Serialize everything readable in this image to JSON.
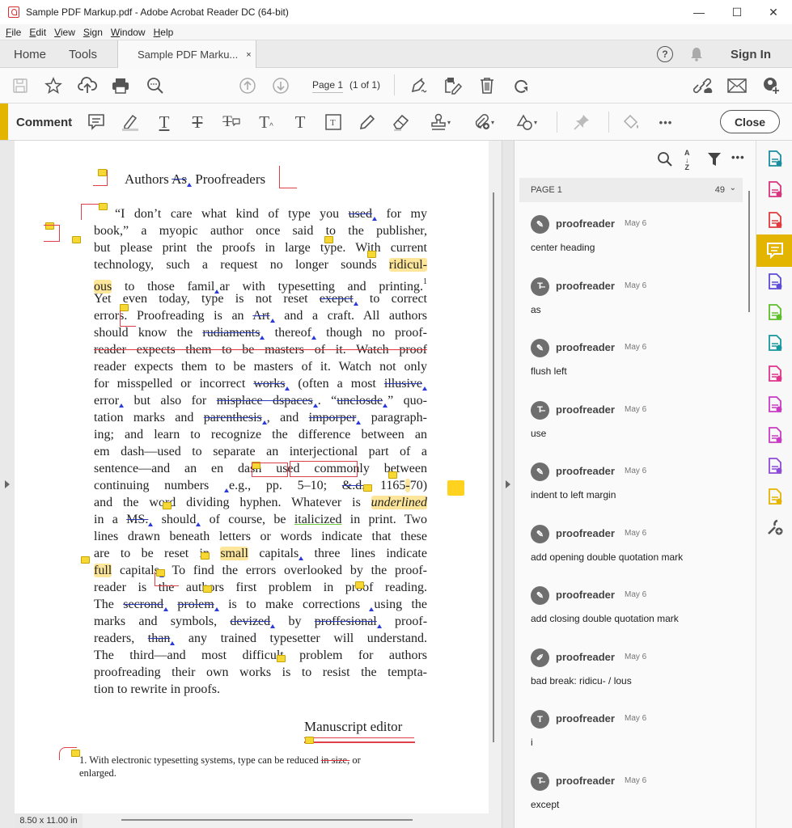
{
  "window": {
    "title": "Sample PDF Markup.pdf - Adobe Acrobat Reader DC (64-bit)",
    "controls": {
      "minimize": "—",
      "maximize": "☐",
      "close": "✕"
    }
  },
  "menu": [
    "File",
    "Edit",
    "View",
    "Sign",
    "Window",
    "Help"
  ],
  "tabs": {
    "home": "Home",
    "tools": "Tools",
    "document": "Sample PDF Marku...",
    "close_glyph": "×",
    "sign_in": "Sign In"
  },
  "toolbar": {
    "page_field": "Page 1",
    "page_of": "(1 of 1)",
    "icons": [
      "save-icon",
      "bookmark-star-icon",
      "cloud-upload-icon",
      "print-icon",
      "zoom-search-icon",
      "page-up-icon",
      "page-down-icon",
      "fill-sign-icon",
      "edit-pdf-icon",
      "delete-icon",
      "rotate-icon",
      "share-link-icon",
      "email-icon",
      "add-user-icon"
    ]
  },
  "comment_toolbar": {
    "label": "Comment",
    "close_label": "Close",
    "more_glyph": "•••",
    "tools": [
      "sticky-note",
      "highlight",
      "underline",
      "strikethrough",
      "replace-text",
      "insert-text",
      "add-text",
      "text-box",
      "pencil",
      "eraser",
      "stamp",
      "attach",
      "shapes",
      "pin",
      "fill-color"
    ]
  },
  "document": {
    "heading": {
      "pre": "Authors ",
      "struck": "As",
      "post": " Proofreaders"
    },
    "lines": [
      [
        {
          "t": "“I don’t care what kind of type you "
        },
        {
          "t": "used",
          "s": "b"
        },
        {
          "c": 1
        },
        {
          "t": " for my"
        }
      ],
      [
        {
          "t": "book,” a myopic author once said to the publisher,"
        }
      ],
      [
        {
          "t": "but please print the proofs in large type. With current"
        }
      ],
      [
        {
          "t": "technology, such a request no longer sounds "
        },
        {
          "t": "ridicul-",
          "h": 1
        }
      ],
      [
        {
          "t": "ous",
          "h": 1
        },
        {
          "t": " to those famil"
        },
        {
          "c": 1
        },
        {
          "t": "ar with typesetting and printing."
        },
        {
          "sup": "1"
        }
      ],
      [
        {
          "t": "Yet even today, type is not reset "
        },
        {
          "t": "exepct",
          "s": "b"
        },
        {
          "c": 1
        },
        {
          "t": " to correct"
        }
      ],
      [
        {
          "t": "errors. Proofreading is an "
        },
        {
          "t": "Art",
          "s": "b"
        },
        {
          "c": 1
        },
        {
          "t": " and a craft. All authors"
        }
      ],
      [
        {
          "t": "should know the "
        },
        {
          "t": "rudiaments",
          "s": "b"
        },
        {
          "c": 1
        },
        {
          "t": " thereof"
        },
        {
          "c": 1
        },
        {
          "t": " though no proof-"
        }
      ],
      [
        {
          "t": "reader expects them to be masters of it. Watch proof",
          "s": "r"
        }
      ],
      [
        {
          "t": "reader expects them to be masters of it. Watch not only"
        }
      ],
      [
        {
          "t": "for misspelled or incorrect "
        },
        {
          "t": "works",
          "s": "b"
        },
        {
          "c": 1
        },
        {
          "t": " (often a most "
        },
        {
          "t": "illusive",
          "s": "b"
        },
        {
          "c": 1
        }
      ],
      [
        {
          "t": "error"
        },
        {
          "c": 1
        },
        {
          "t": " but also for "
        },
        {
          "t": "misplace dspaces",
          "s": "b"
        },
        {
          "c": 1
        },
        {
          "t": ". “"
        },
        {
          "t": "unclosde",
          "s": "b"
        },
        {
          "c": 1
        },
        {
          "t": "” quo-"
        }
      ],
      [
        {
          "t": "tation marks and "
        },
        {
          "t": "parenthesis",
          "s": "b"
        },
        {
          "c": 1
        },
        {
          "t": ", and "
        },
        {
          "t": "imporper",
          "s": "b"
        },
        {
          "c": 1
        },
        {
          "t": " paragraph-"
        }
      ],
      [
        {
          "t": "ing; and learn to recognize the difference between an"
        }
      ],
      [
        {
          "t": "em dash—used to separate an interjectional part of a"
        }
      ],
      [
        {
          "t": "sentence—and an en dash used commonly between"
        }
      ],
      [
        {
          "t": "continuing numbers "
        },
        {
          "c": 1
        },
        {
          "t": "e.g., pp. 5–10; "
        },
        {
          "t": "&.d.",
          "s": "b"
        },
        {
          "t": " 1165"
        },
        {
          "t": "-",
          "h": 1
        },
        {
          "t": "70)"
        }
      ],
      [
        {
          "t": "and the word dividing hyphen. Whatever is "
        },
        {
          "t": "underlined",
          "h": 1,
          "i": 1
        }
      ],
      [
        {
          "t": "in a "
        },
        {
          "t": "MS.",
          "s": "b"
        },
        {
          "c": 1
        },
        {
          "t": " should"
        },
        {
          "c": 1
        },
        {
          "t": " of course, be "
        },
        {
          "t": "italicized",
          "u": 1
        },
        {
          "t": " in print. Two"
        }
      ],
      [
        {
          "t": "lines drawn beneath letters or words indicate that these"
        }
      ],
      [
        {
          "t": "are to be reset in "
        },
        {
          "t": "small",
          "h": 1
        },
        {
          "t": " capitals"
        },
        {
          "c": 1
        },
        {
          "t": " three lines indicate"
        }
      ],
      [
        {
          "t": "full",
          "h": 1
        },
        {
          "t": " capitals"
        },
        {
          "c": 1
        },
        {
          "t": " To find the errors overlooked by the proof-"
        }
      ],
      [
        {
          "t": "reader is the authors first problem in proof reading."
        }
      ],
      [
        {
          "t": "The "
        },
        {
          "t": "secrond",
          "s": "b"
        },
        {
          "c": 1
        },
        {
          "t": " "
        },
        {
          "t": "prolem",
          "s": "b"
        },
        {
          "c": 1
        },
        {
          "t": " is to make corrections "
        },
        {
          "c": 1
        },
        {
          "t": "using the"
        }
      ],
      [
        {
          "t": "marks and symbols, "
        },
        {
          "t": "devized",
          "s": "b"
        },
        {
          "c": 1
        },
        {
          "t": " by "
        },
        {
          "t": "proffesional",
          "s": "b"
        },
        {
          "c": 1
        },
        {
          "t": " proof-"
        }
      ],
      [
        {
          "t": "readers, "
        },
        {
          "t": "than",
          "s": "b"
        },
        {
          "c": 1
        },
        {
          "t": " any trained typesetter will understand."
        }
      ],
      [
        {
          "t": "The third—and most difficult problem for authors"
        }
      ],
      [
        {
          "t": "proofreading their own works is to resist the tempta-"
        }
      ],
      [
        {
          "t": "tion to rewrite in proofs."
        }
      ]
    ],
    "signature": "Manuscript editor",
    "footnote": {
      "pre": "1. With electronic typesetting systems, type can be reduced ",
      "struck": "in size,",
      "post": " or",
      "line2": "enlarged."
    },
    "page_size": "8.50 x 11.00 in"
  },
  "comments_panel": {
    "group_label": "PAGE 1",
    "count": "49",
    "items": [
      {
        "author": "proofreader",
        "date": "May 6",
        "text": "center heading",
        "icon": "pencil-icon",
        "glyph": "✎"
      },
      {
        "author": "proofreader",
        "date": "May 6",
        "text": "as",
        "icon": "strikethrough-icon",
        "glyph": "T̶"
      },
      {
        "author": "proofreader",
        "date": "May 6",
        "text": "flush left",
        "icon": "pencil-icon",
        "glyph": "✎"
      },
      {
        "author": "proofreader",
        "date": "May 6",
        "text": "use",
        "icon": "strikethrough-icon",
        "glyph": "T̶"
      },
      {
        "author": "proofreader",
        "date": "May 6",
        "text": "indent to left margin",
        "icon": "pencil-icon",
        "glyph": "✎"
      },
      {
        "author": "proofreader",
        "date": "May 6",
        "text": "add opening double quotation mark",
        "icon": "pencil-icon",
        "glyph": "✎"
      },
      {
        "author": "proofreader",
        "date": "May 6",
        "text": "add closing double quotation mark",
        "icon": "pencil-icon",
        "glyph": "✎"
      },
      {
        "author": "proofreader",
        "date": "May 6",
        "text": "bad break: ridicu- / lous",
        "icon": "highlight-icon",
        "glyph": "✐"
      },
      {
        "author": "proofreader",
        "date": "May 6",
        "text": "i",
        "icon": "insert-text-icon",
        "glyph": "T"
      },
      {
        "author": "proofreader",
        "date": "May 6",
        "text": "except",
        "icon": "strikethrough-icon",
        "glyph": "T̶"
      }
    ]
  },
  "right_rail": [
    {
      "name": "export-pdf-icon",
      "color": "#1b8e9e"
    },
    {
      "name": "organize-pages-icon",
      "color": "#d6347f"
    },
    {
      "name": "create-pdf-icon",
      "color": "#e03a3e"
    },
    {
      "name": "comment-icon",
      "color": "#ffffff",
      "active": true
    },
    {
      "name": "combine-files-icon",
      "color": "#5b4bd6"
    },
    {
      "name": "compress-pdf-icon",
      "color": "#5cbf2a"
    },
    {
      "name": "scan-ocr-icon",
      "color": "#15979d"
    },
    {
      "name": "fill-sign-icon",
      "color": "#e0338a"
    },
    {
      "name": "protect-icon",
      "color": "#c93bc4"
    },
    {
      "name": "redact-icon",
      "color": "#c93bc4"
    },
    {
      "name": "request-signature-icon",
      "color": "#8e4bd6"
    },
    {
      "name": "send-comment-icon",
      "color": "#e3b400"
    },
    {
      "name": "more-tools-icon",
      "color": "#555555"
    }
  ],
  "colors": {
    "accent": "#e3b400",
    "markup_red": "#e0404a",
    "markup_blue": "#2b3bd8",
    "highlight": "#fde69a"
  }
}
